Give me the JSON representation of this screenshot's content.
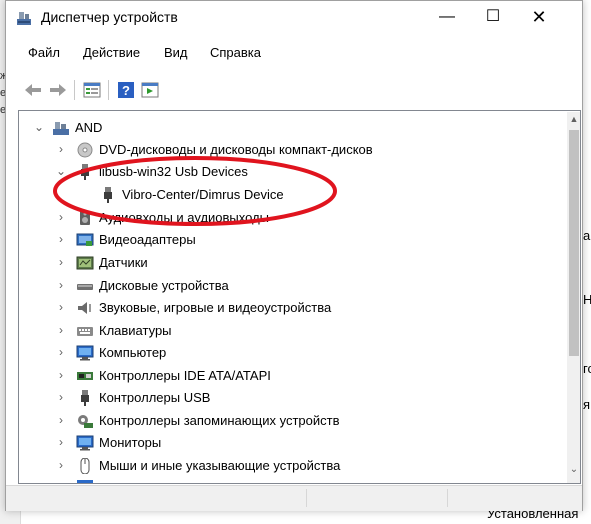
{
  "window": {
    "title": "Диспетчер устройств"
  },
  "titlebar": {
    "minimize": "—",
    "maximize": "☐",
    "close": "✕"
  },
  "menu": [
    "Файл",
    "Действие",
    "Вид",
    "Справка"
  ],
  "toolbar": {
    "icons": [
      "back-arrow-icon",
      "forward-arrow-icon",
      "properties-icon",
      "help-icon",
      "run-icon"
    ]
  },
  "tree": {
    "root": {
      "label": "AND",
      "expanded": true
    },
    "items": [
      {
        "label": "DVD-дисководы и дисководы компакт-дисков",
        "icon": "dvd-drive-icon",
        "expanded": false
      },
      {
        "label": "libusb-win32 Usb Devices",
        "icon": "usb-plug-icon",
        "expanded": true,
        "children": [
          {
            "label": "Vibro-Center/Dimrus Device",
            "icon": "usb-plug-icon"
          }
        ]
      },
      {
        "label": "Аудиовходы и аудиовыходы",
        "icon": "speaker-icon",
        "expanded": false
      },
      {
        "label": "Видеоадаптеры",
        "icon": "display-adapter-icon",
        "expanded": false
      },
      {
        "label": "Датчики",
        "icon": "sensor-icon",
        "expanded": false
      },
      {
        "label": "Дисковые устройства",
        "icon": "disk-drive-icon",
        "expanded": false
      },
      {
        "label": "Звуковые, игровые и видеоустройства",
        "icon": "speaker-icon",
        "expanded": false
      },
      {
        "label": "Клавиатуры",
        "icon": "keyboard-icon",
        "expanded": false
      },
      {
        "label": "Компьютер",
        "icon": "monitor-icon",
        "expanded": false
      },
      {
        "label": "Контроллеры IDE ATA/ATAPI",
        "icon": "ide-controller-icon",
        "expanded": false
      },
      {
        "label": "Контроллеры USB",
        "icon": "usb-plug-icon",
        "expanded": false
      },
      {
        "label": "Контроллеры запоминающих устройств",
        "icon": "storage-controller-icon",
        "expanded": false
      },
      {
        "label": "Мониторы",
        "icon": "monitor-icon",
        "expanded": false
      },
      {
        "label": "Мыши и иные указывающие устройства",
        "icon": "mouse-icon",
        "expanded": false
      }
    ]
  },
  "background": {
    "left_fragments": [
      "ж",
      "ен",
      "ех"
    ],
    "right_fragments": [
      "а",
      "Н",
      "го",
      "я"
    ],
    "bottom_text": "Установленная"
  },
  "colors": {
    "annotation_ellipse": "#e0141e",
    "scroll_thumb": "#c1c1c1"
  }
}
